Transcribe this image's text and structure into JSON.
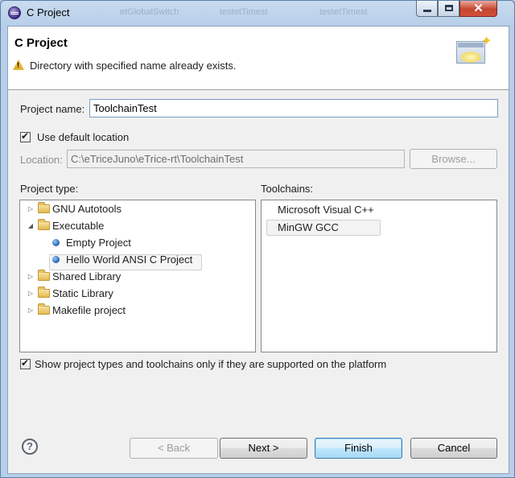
{
  "window": {
    "title": "C Project"
  },
  "background_tabs": [
    "etGlobalSwitch",
    "testetTimest",
    "testetTimest"
  ],
  "header": {
    "title": "C Project",
    "message": "Directory with specified name already exists.",
    "message_icon": "warning-icon"
  },
  "form": {
    "project_name_label": "Project name:",
    "project_name_value": "ToolchainTest",
    "use_default_location_label": "Use default location",
    "use_default_location_checked": true,
    "location_label": "Location:",
    "location_value": "C:\\eTriceJuno\\eTrice-rt\\ToolchainTest",
    "browse_label": "Browse..."
  },
  "project_type": {
    "label": "Project type:",
    "items": [
      {
        "label": "GNU Autotools",
        "kind": "folder",
        "expanded": false
      },
      {
        "label": "Executable",
        "kind": "folder",
        "expanded": true
      },
      {
        "label": "Empty Project",
        "kind": "item"
      },
      {
        "label": "Hello World ANSI C Project",
        "kind": "item",
        "selected": true
      },
      {
        "label": "Shared Library",
        "kind": "folder",
        "expanded": false
      },
      {
        "label": "Static Library",
        "kind": "folder",
        "expanded": false
      },
      {
        "label": "Makefile project",
        "kind": "folder",
        "expanded": false
      }
    ]
  },
  "toolchains": {
    "label": "Toolchains:",
    "items": [
      {
        "label": "Microsoft Visual C++"
      },
      {
        "label": "MinGW GCC",
        "selected": true
      }
    ]
  },
  "filter": {
    "label": "Show project types and toolchains only if they are supported on the platform",
    "checked": true
  },
  "buttons": {
    "back": "< Back",
    "next": "Next >",
    "finish": "Finish",
    "cancel": "Cancel"
  },
  "colors": {
    "accent": "#3c7fb1",
    "warning": "#e2b233"
  }
}
